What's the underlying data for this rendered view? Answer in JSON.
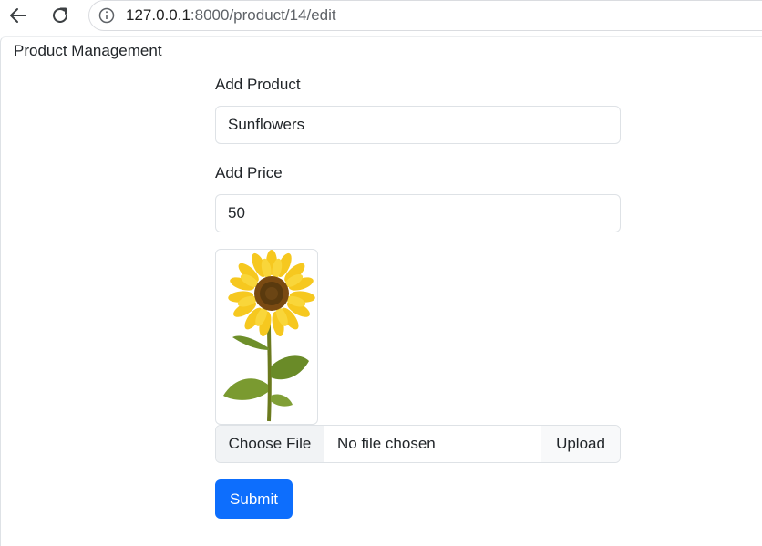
{
  "browser": {
    "url_host": "127.0.0.1",
    "url_rest": ":8000/product/14/edit"
  },
  "page": {
    "brand": "Product Management"
  },
  "form": {
    "product_label": "Add Product",
    "product_value": "Sunflowers",
    "price_label": "Add Price",
    "price_value": "50",
    "image_alt": "sunflower",
    "choose_file_label": "Choose File",
    "file_status": "No file chosen",
    "upload_label": "Upload",
    "submit_label": "Submit"
  },
  "colors": {
    "primary": "#0d6efd",
    "border": "#dee2e6"
  },
  "icons": [
    "back-arrow-icon",
    "reload-icon",
    "info-icon"
  ]
}
